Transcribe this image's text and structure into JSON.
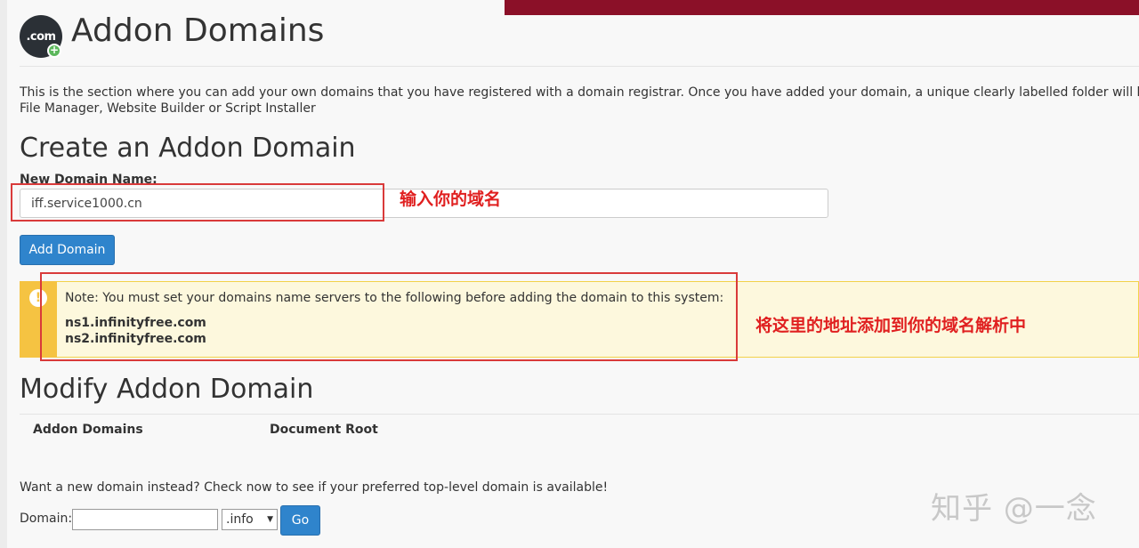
{
  "header": {
    "logo_text": ".com",
    "logo_plus": "+",
    "title": "Addon Domains"
  },
  "intro": {
    "line1": "This is the section where you can add your own domains that you have registered with a domain registrar. Once you have added your domain, a unique clearly labelled folder will be created on o",
    "line2": "File Manager, Website Builder or Script Installer"
  },
  "create": {
    "heading": "Create an Addon Domain",
    "field_label": "New Domain Name:",
    "field_value": "iff.service1000.cn",
    "button": "Add Domain"
  },
  "alert": {
    "icon": "!",
    "note": "Note: You must set your domains name servers to the following before adding the domain to this system:",
    "ns1": "ns1.infinityfree.com",
    "ns2": "ns2.infinityfree.com"
  },
  "modify": {
    "heading": "Modify Addon Domain",
    "columns": [
      "Addon Domains",
      "Document Root"
    ]
  },
  "search": {
    "prompt": "Want a new domain instead? Check now to see if your preferred top-level domain is available!",
    "domain_label": "Domain:",
    "domain_value": "",
    "tld_selected": ".info",
    "button": "Go"
  },
  "annotations": {
    "enter_domain": "输入你的域名",
    "add_nameservers": "将这里的地址添加到你的域名解析中"
  },
  "watermark": "知乎 @一念",
  "colors": {
    "top_bar": "#8b1028",
    "primary_button": "#2f84cc",
    "alert_background": "#fdf8dd",
    "alert_accent": "#f5c342",
    "annotation": "#e02020"
  }
}
